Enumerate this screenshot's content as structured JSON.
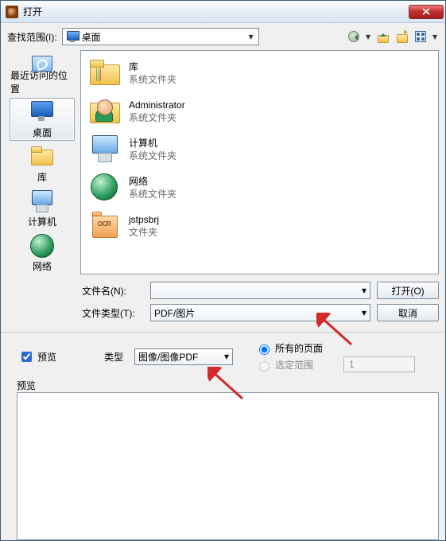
{
  "window": {
    "title": "打开"
  },
  "lookin": {
    "label": "查找范围(I):",
    "value": "桌面"
  },
  "toolbar": {
    "back": "back-icon",
    "up": "up-one-level-icon",
    "newfolder": "new-folder-icon",
    "views": "views-icon"
  },
  "places": [
    {
      "key": "recent",
      "label": "最近访问的位置"
    },
    {
      "key": "desktop",
      "label": "桌面"
    },
    {
      "key": "library",
      "label": "库"
    },
    {
      "key": "computer",
      "label": "计算机"
    },
    {
      "key": "network",
      "label": "网络"
    }
  ],
  "files": [
    {
      "name": "库",
      "sub": "系统文件夹",
      "icon": "library"
    },
    {
      "name": "Administrator",
      "sub": "系统文件夹",
      "icon": "user"
    },
    {
      "name": "计算机",
      "sub": "系统文件夹",
      "icon": "computer"
    },
    {
      "name": "网络",
      "sub": "系统文件夹",
      "icon": "network"
    },
    {
      "name": "jstpsbrj",
      "sub": "文件夹",
      "icon": "ocr-folder"
    }
  ],
  "fields": {
    "filename_label": "文件名(N):",
    "filename_value": "",
    "filetype_label": "文件类型(T):",
    "filetype_value": "PDF/图片",
    "open_btn": "打开(O)",
    "cancel_btn": "取消"
  },
  "lower": {
    "preview_chk": "预览",
    "type_label": "类型",
    "type_value": "图像/图像PDF",
    "radio_all": "所有的页面",
    "radio_range": "选定范围",
    "range_value": "1",
    "preview_section": "预览"
  }
}
